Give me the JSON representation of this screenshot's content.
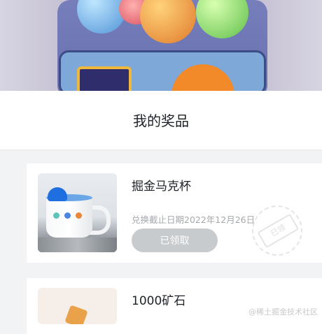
{
  "page": {
    "title": "我的奖品"
  },
  "prizes": [
    {
      "name": "掘金马克杯",
      "deadline": "兑换截止日期2022年12月26日",
      "status_button": "已领取",
      "stamp_text": "已领",
      "thumb_icon": "mug-image"
    },
    {
      "name": "1000矿石",
      "thumb_icon": "ore-image"
    }
  ],
  "watermark": "@稀土掘金技术社区",
  "colors": {
    "background": "#f2f3f5",
    "card": "#ffffff",
    "claimed_button": "#c8cbce",
    "muted_text": "#a5a8ad",
    "primary_text": "#1d2129"
  }
}
